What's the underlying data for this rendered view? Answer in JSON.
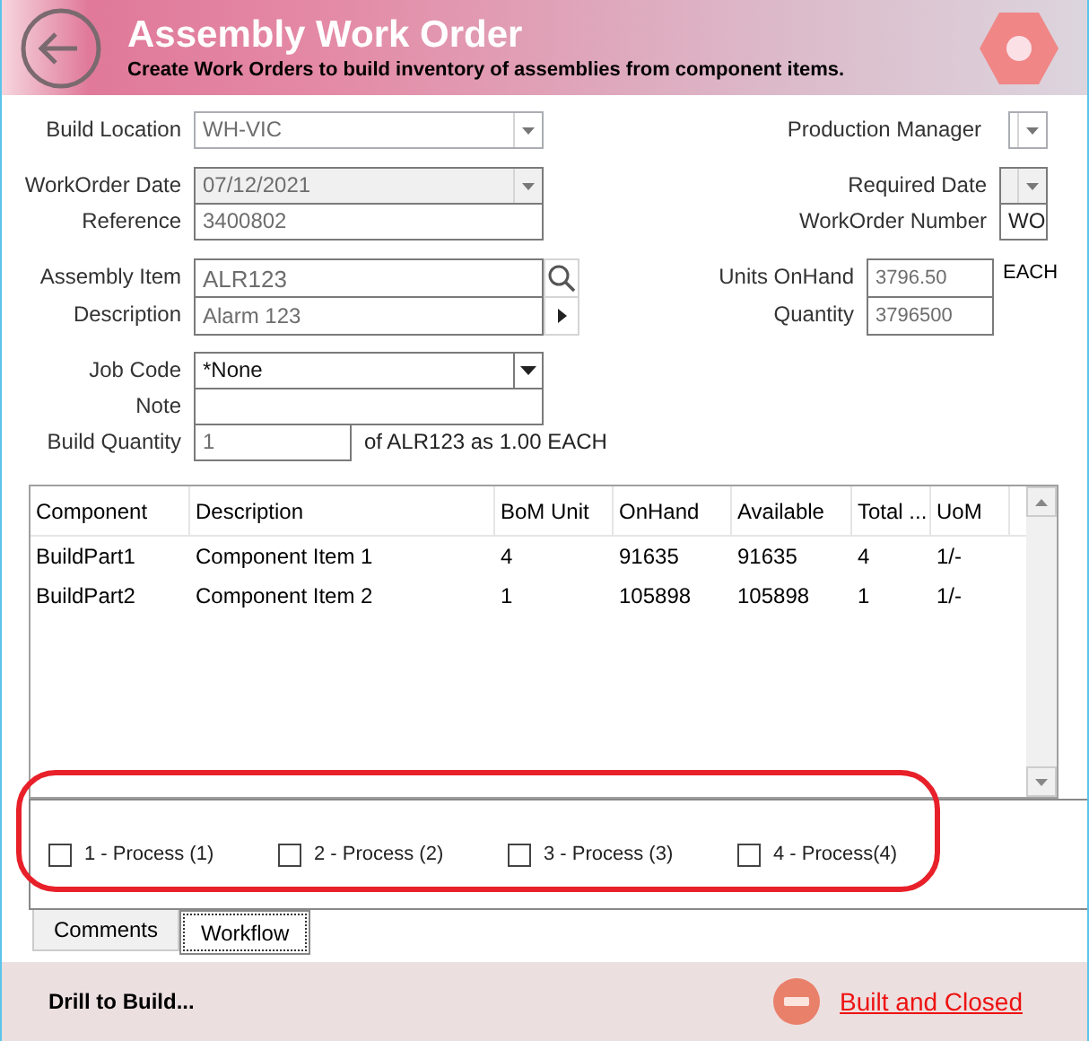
{
  "header": {
    "title": "Assembly Work Order",
    "subtitle": "Create Work Orders to build inventory of assemblies from component items."
  },
  "build_location": {
    "label": "Build Location",
    "value": "WH-VIC"
  },
  "production_manager": {
    "label": "Production Manager"
  },
  "workorder_date": {
    "label": "WorkOrder Date",
    "value": "07/12/2021"
  },
  "reference": {
    "label": "Reference",
    "value": "3400802"
  },
  "required_date": {
    "label": "Required Date"
  },
  "workorder_number": {
    "label": "WorkOrder Number",
    "value": "WO"
  },
  "assembly_item": {
    "label": "Assembly Item",
    "value": "ALR123"
  },
  "description": {
    "label": "Description",
    "value": "Alarm 123"
  },
  "units_onhand": {
    "label": "Units OnHand",
    "value": "3796.50",
    "unit": "EACH"
  },
  "quantity": {
    "label": "Quantity",
    "value": "3796500"
  },
  "job_code": {
    "label": "Job Code",
    "value": "*None"
  },
  "note": {
    "label": "Note"
  },
  "build_quantity": {
    "label": "Build Quantity",
    "value": "1",
    "hint": "of ALR123 as 1.00 EACH"
  },
  "table": {
    "columns": [
      "Component",
      "Description",
      "BoM Unit",
      "OnHand",
      "Available",
      "Total ...",
      "UoM"
    ],
    "rows": [
      [
        "BuildPart1",
        "Component Item 1",
        "4",
        "91635",
        "91635",
        "4",
        "1/-"
      ],
      [
        "BuildPart2",
        "Component Item 2",
        "1",
        "105898",
        "105898",
        "1",
        "1/-"
      ]
    ]
  },
  "workflow": [
    {
      "label": "1 - Process (1)",
      "checked": false
    },
    {
      "label": "2 - Process (2)",
      "checked": false
    },
    {
      "label": "3 - Process (3)",
      "checked": false
    },
    {
      "label": "4 - Process(4)",
      "checked": false
    }
  ],
  "tabs": [
    {
      "label": "Comments",
      "selected": false
    },
    {
      "label": "Workflow",
      "selected": true
    }
  ],
  "footer": {
    "drill": "Drill to Build...",
    "status_link": "Built and Closed"
  }
}
